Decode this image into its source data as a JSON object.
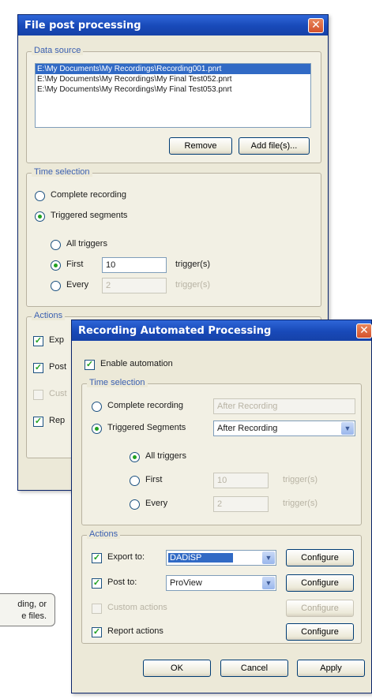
{
  "tooltip": {
    "line1": "ding, or",
    "line2": "e files."
  },
  "dialog1": {
    "title": "File post processing",
    "data_source": {
      "legend": "Data source",
      "files": [
        "E:\\My Documents\\My Recordings\\Recording001.pnrt",
        "E:\\My Documents\\My Recordings\\My Final Test052.pnrt",
        "E:\\My Documents\\My Recordings\\My Final Test053.pnrt"
      ],
      "remove_label": "Remove",
      "add_label": "Add file(s)..."
    },
    "time_selection": {
      "legend": "Time selection",
      "complete_label": "Complete recording",
      "triggered_label": "Triggered segments",
      "all_label": "All triggers",
      "first_label": "First",
      "first_value": "10",
      "first_unit": "trigger(s)",
      "every_label": "Every",
      "every_value": "2",
      "every_unit": "trigger(s)"
    },
    "actions": {
      "legend": "Actions",
      "items": [
        "Exp",
        "Post",
        "Cust",
        "Rep"
      ]
    }
  },
  "dialog2": {
    "title": "Recording Automated Processing",
    "enable_label": "Enable automation",
    "time_selection": {
      "legend": "Time selection",
      "complete_label": "Complete recording",
      "complete_value": "After Recording",
      "triggered_label": "Triggered Segments",
      "triggered_value": "After Recording",
      "all_label": "All triggers",
      "first_label": "First",
      "first_value": "10",
      "first_unit": "trigger(s)",
      "every_label": "Every",
      "every_value": "2",
      "every_unit": "trigger(s)"
    },
    "actions": {
      "legend": "Actions",
      "export_label": "Export to:",
      "export_value": "DADiSP",
      "post_label": "Post to:",
      "post_value": "ProView",
      "custom_label": "Custom actions",
      "report_label": "Report actions",
      "configure_label": "Configure"
    },
    "ok_label": "OK",
    "cancel_label": "Cancel",
    "apply_label": "Apply"
  }
}
